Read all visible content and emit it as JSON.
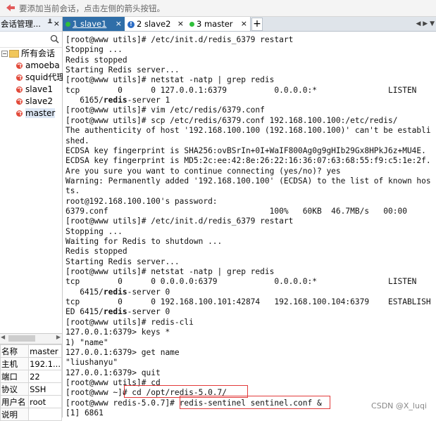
{
  "top_hint": "要添加当前会话，点击左侧的箭头按钮。",
  "sidebar": {
    "header_title": "会话管理...",
    "pin_glyph": "╨",
    "close_glyph": "×",
    "root_label": "所有会话",
    "sessions": [
      "amoeba",
      "squid代理",
      "slave1",
      "slave2",
      "master"
    ]
  },
  "properties": [
    {
      "key": "名称",
      "value": "master"
    },
    {
      "key": "主机",
      "value": "192.1..."
    },
    {
      "key": "端口",
      "value": "22"
    },
    {
      "key": "协议",
      "value": "SSH"
    },
    {
      "key": "用户名",
      "value": "root"
    },
    {
      "key": "说明",
      "value": ""
    }
  ],
  "tabs": [
    {
      "label": "1 slave1",
      "status_color": "#2fbf3a"
    },
    {
      "label": "2 slave2",
      "status": "info"
    },
    {
      "label": "3 master",
      "status_color": "#2fbf3a"
    }
  ],
  "add_tab": "+",
  "tab_nav": "◀ ▶ ▼",
  "terminal": {
    "lines": [
      "[root@www utils]# /etc/init.d/redis_6379 restart",
      "Stopping ...",
      "Redis stopped",
      "Starting Redis server...",
      "[root@www utils]# netstat -natp | grep redis",
      "tcp        0      0 127.0.0.1:6379          0.0.0.0:*               LISTEN",
      "   6165/redis-server 1",
      "[root@www utils]# vim /etc/redis/6379.conf",
      "[root@www utils]# scp /etc/redis/6379.conf 192.168.100.100:/etc/redis/",
      "The authenticity of host '192.168.100.100 (192.168.100.100)' can't be establi",
      "shed.",
      "ECDSA key fingerprint is SHA256:ovBSrIn+0I+WaIF800Ag0g9gHIb29Gx8HPkJ6z+MU4E.",
      "ECDSA key fingerprint is MD5:2c:ee:42:8e:26:22:16:36:07:63:68:55:f9:c5:1e:2f.",
      "Are you sure you want to continue connecting (yes/no)? yes",
      "Warning: Permanently added '192.168.100.100' (ECDSA) to the list of known hos",
      "ts.",
      "root@192.168.100.100's password:",
      "6379.conf                                  100%   60KB  46.7MB/s   00:00",
      "[root@www utils]# /etc/init.d/redis_6379 restart",
      "Stopping ...",
      "Waiting for Redis to shutdown ...",
      "Redis stopped",
      "Starting Redis server...",
      "[root@www utils]# netstat -natp | grep redis",
      "tcp        0      0 0.0.0.0:6379            0.0.0.0:*               LISTEN",
      "   6415/redis-server 0",
      "tcp        0      0 192.168.100.101:42874   192.168.100.104:6379    ESTABLISH",
      "ED 6415/redis-server 0",
      "[root@www utils]# redis-cli",
      "127.0.0.1:6379> keys *",
      "1) \"name\"",
      "127.0.0.1:6379> get name",
      "\"liushanyu\"",
      "127.0.0.1:6379> quit",
      "[root@www utils]# cd",
      "[root@www ~]# cd /opt/redis-5.0.7/",
      "[root@www redis-5.0.7]# redis-sentinel sentinel.conf &",
      "[1] 6861"
    ]
  },
  "watermark": "CSDN @X_luqi",
  "highlight_color": "#e23a3a"
}
